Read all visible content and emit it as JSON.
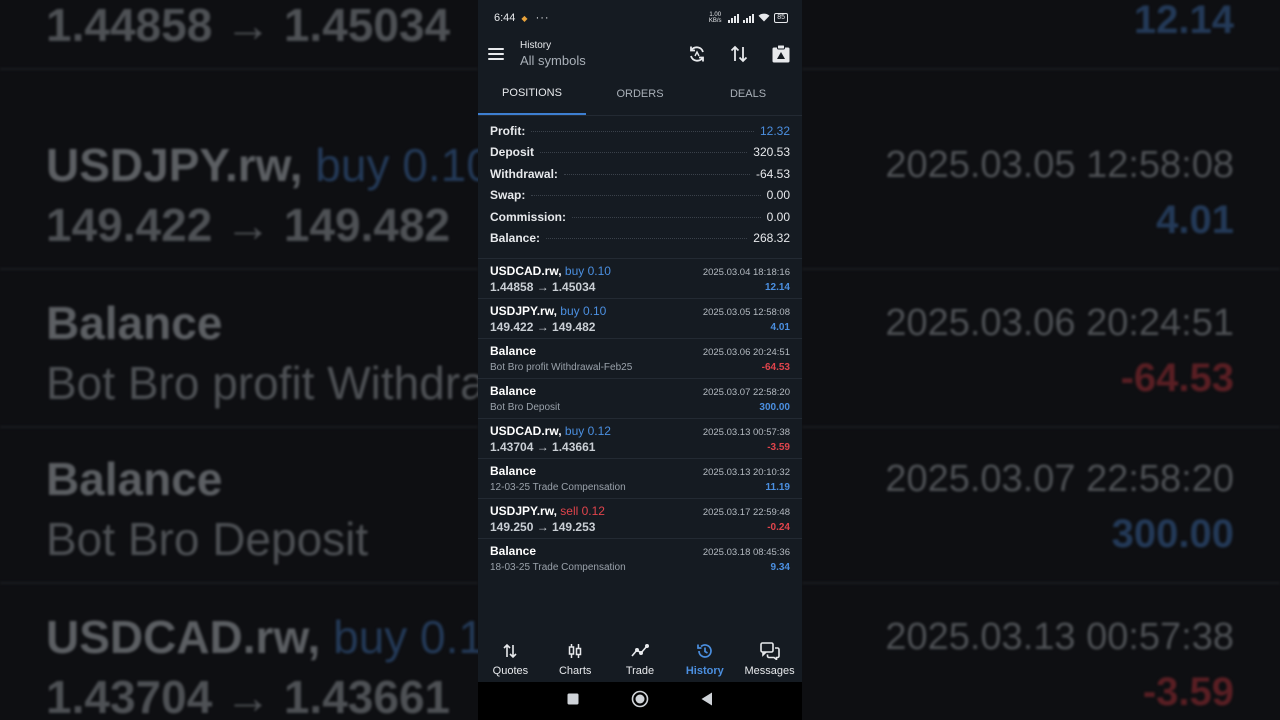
{
  "status_bar": {
    "time": "6:44",
    "net_speed": "1.00 KB/s",
    "battery": "85"
  },
  "app_bar": {
    "title": "History",
    "subtitle": "All symbols"
  },
  "tabs": [
    {
      "label": "POSITIONS",
      "active": true
    },
    {
      "label": "ORDERS",
      "active": false
    },
    {
      "label": "DEALS",
      "active": false
    }
  ],
  "summary": {
    "profit": {
      "label": "Profit:",
      "value": "12.32"
    },
    "deposit": {
      "label": "Deposit",
      "value": "320.53"
    },
    "withdrawal": {
      "label": "Withdrawal:",
      "value": "-64.53"
    },
    "swap": {
      "label": "Swap:",
      "value": "0.00"
    },
    "commission": {
      "label": "Commission:",
      "value": "0.00"
    },
    "balance": {
      "label": "Balance:",
      "value": "268.32"
    }
  },
  "deals": [
    {
      "symbol": "USDCAD.rw,",
      "direction": "buy 0.10",
      "line2": "1.44858 → 1.45034",
      "date": "2025.03.04 18:18:16",
      "amount": "12.14"
    },
    {
      "symbol": "USDJPY.rw,",
      "direction": "buy 0.10",
      "line2": "149.422 → 149.482",
      "date": "2025.03.05 12:58:08",
      "amount": "4.01"
    },
    {
      "symbol": "Balance",
      "direction": "",
      "line2": "Bot Bro profit Withdrawal-Feb25",
      "date": "2025.03.06 20:24:51",
      "amount": "-64.53"
    },
    {
      "symbol": "Balance",
      "direction": "",
      "line2": "Bot Bro Deposit",
      "date": "2025.03.07 22:58:20",
      "amount": "300.00"
    },
    {
      "symbol": "USDCAD.rw,",
      "direction": "buy 0.12",
      "line2": "1.43704 → 1.43661",
      "date": "2025.03.13 00:57:38",
      "amount": "-3.59"
    },
    {
      "symbol": "Balance",
      "direction": "",
      "line2": "12-03-25 Trade Compensation",
      "date": "2025.03.13 20:10:32",
      "amount": "11.19"
    },
    {
      "symbol": "USDJPY.rw,",
      "direction": "sell 0.12",
      "line2": "149.250 → 149.253",
      "date": "2025.03.17 22:59:48",
      "amount": "-0.24"
    },
    {
      "symbol": "Balance",
      "direction": "",
      "line2": "18-03-25 Trade Compensation",
      "date": "2025.03.18 08:45:36",
      "amount": "9.34"
    }
  ],
  "bottom_nav": [
    {
      "label": "Quotes",
      "icon": "quotes-icon"
    },
    {
      "label": "Charts",
      "icon": "charts-icon"
    },
    {
      "label": "Trade",
      "icon": "trade-icon"
    },
    {
      "label": "History",
      "icon": "history-icon",
      "active": true
    },
    {
      "label": "Messages",
      "icon": "messages-icon"
    }
  ],
  "colors": {
    "accent": "#4b8fe0",
    "negative": "#e0444c",
    "background": "#151b22"
  }
}
